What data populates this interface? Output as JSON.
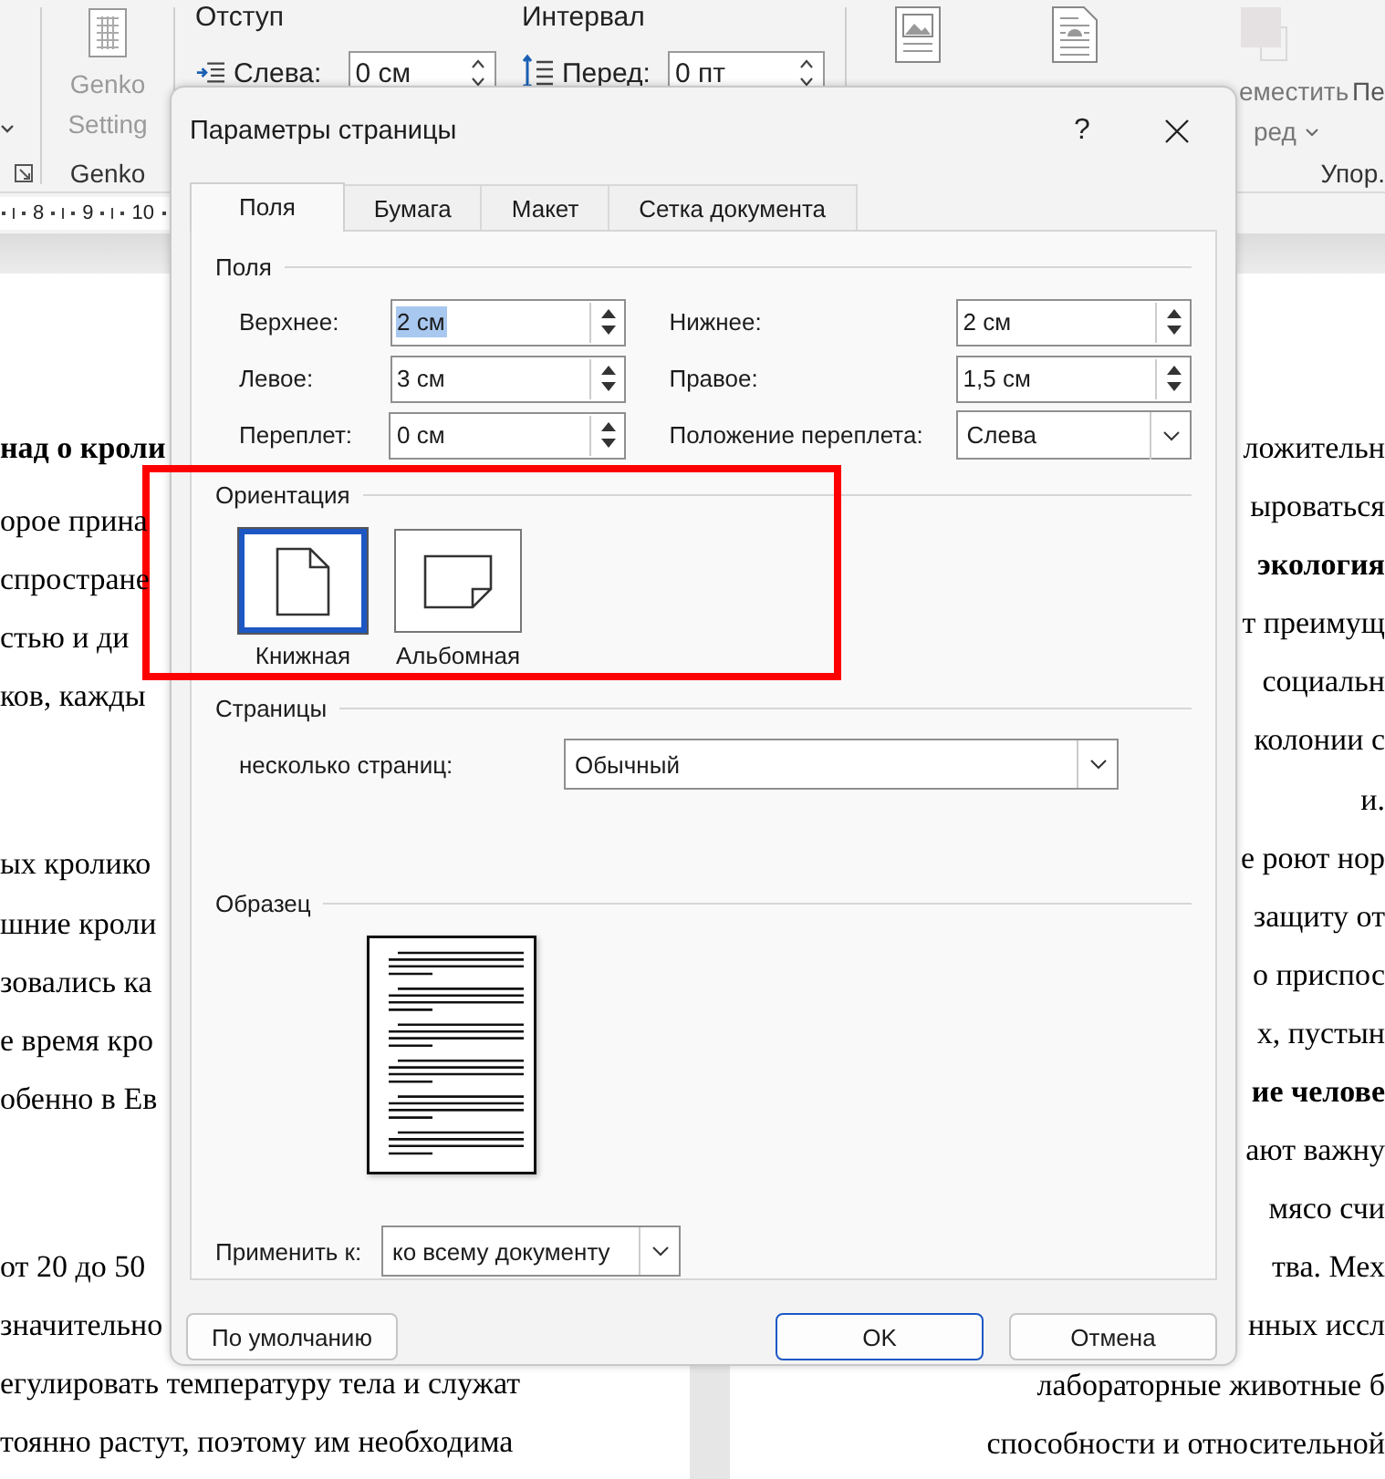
{
  "ribbon": {
    "genko": {
      "label_lines": [
        "Genko",
        "Setting"
      ],
      "group": "Genko",
      "disabled": true
    },
    "paragraph": [
      {
        "kind": "indent",
        "title": "Отступ",
        "label": "Слева:",
        "value": "0 см"
      },
      {
        "kind": "spacing",
        "title": "Интервал",
        "label": "Перед:",
        "value": "0 пт"
      }
    ],
    "arrange": {
      "group": "Упор.",
      "buttons": [
        {
          "kind": "picture",
          "disabled": false
        },
        {
          "kind": "wrap",
          "disabled": false
        },
        {
          "kind": "forward",
          "disabled": true,
          "lines": [
            "еместить",
            "ред"
          ],
          "dropdown": true
        },
        {
          "kind": "next",
          "disabled": false,
          "lines": [
            "Пе"
          ],
          "dropdown": false
        }
      ]
    }
  },
  "ruler": {
    "marks": [
      "8",
      "9",
      "10"
    ]
  },
  "document": {
    "left_page": [
      {
        "lines": [
          {
            "text": "над о кроли",
            "bold": true
          }
        ]
      },
      {
        "lines": [
          {
            "text": "орое прина",
            "bold": false
          },
          {
            "text": "спростране",
            "bold": false
          },
          {
            "text": "стью и ди",
            "bold": false
          },
          {
            "text": "ков, кажды",
            "bold": false
          }
        ]
      },
      {
        "lines": [
          {
            "text": "ых кролико",
            "bold": false
          },
          {
            "text": "шние кроли",
            "bold": false
          },
          {
            "text": "зовались ка",
            "bold": false
          },
          {
            "text": "е время кро",
            "bold": false
          },
          {
            "text": "обенно в Ев",
            "bold": false
          }
        ]
      },
      {
        "lines": [
          {
            "text": "от 20 до 50",
            "bold": false
          },
          {
            "text": "значительно",
            "bold": false
          },
          {
            "text": "егулировать температуру тела и служат",
            "bold": false
          },
          {
            "text": "тоянно растут, поэтому им необходима",
            "bold": false
          }
        ]
      }
    ],
    "right_page": [
      {
        "text": "ложительн",
        "bold": false
      },
      {
        "text": "ыроваться",
        "bold": false
      },
      {
        "text": "экология",
        "bold": true
      },
      {
        "text": "т преимущ",
        "bold": false
      },
      {
        "text": "социальн",
        "bold": false
      },
      {
        "text": "колонии с",
        "bold": false
      },
      {
        "text": "и.",
        "bold": false
      },
      {
        "text": "е роют нор",
        "bold": false
      },
      {
        "text": "защиту от",
        "bold": false
      },
      {
        "text": "о приспос",
        "bold": false
      },
      {
        "text": "х, пустын",
        "bold": false
      },
      {
        "text": "ие челове",
        "bold": true
      },
      {
        "text": "ают важну",
        "bold": false
      },
      {
        "text": "мясо счи",
        "bold": false
      },
      {
        "text": "тва. Мех",
        "bold": false
      },
      {
        "text": "нных иссл",
        "bold": false
      },
      {
        "text": "лабораторные животные б",
        "bold": false
      },
      {
        "text": "способности и относительной",
        "bold": false
      }
    ]
  },
  "dialog": {
    "title": "Параметры страницы",
    "help": "?",
    "tabs": [
      {
        "label": "Поля",
        "selected": true
      },
      {
        "label": "Бумага",
        "selected": false
      },
      {
        "label": "Макет",
        "selected": false
      },
      {
        "label": "Сетка документа",
        "selected": false
      }
    ],
    "margins": {
      "title": "Поля",
      "rows": [
        [
          {
            "label": "Верхнее:",
            "kind": "spin",
            "value": "2 см",
            "text_selected": true
          },
          {
            "label": "Нижнее:",
            "kind": "spin",
            "value": "2 см",
            "text_selected": false
          }
        ],
        [
          {
            "label": "Левое:",
            "kind": "spin",
            "value": "3 см",
            "text_selected": false
          },
          {
            "label": "Правое:",
            "kind": "spin",
            "value": "1,5 см",
            "text_selected": false
          }
        ],
        [
          {
            "label": "Переплет:",
            "kind": "spin",
            "value": "0 см",
            "text_selected": false
          },
          {
            "label": "Положение переплета:",
            "kind": "dropdown",
            "value": "Слева",
            "text_selected": false
          }
        ]
      ]
    },
    "orientation": {
      "title": "Ориентация",
      "options": [
        {
          "kind": "portrait",
          "label": "Книжная",
          "selected": true
        },
        {
          "kind": "landscape",
          "label": "Альбомная",
          "selected": false
        }
      ]
    },
    "pages": {
      "title": "Страницы",
      "label": "несколько страниц:",
      "value": "Обычный"
    },
    "preview": {
      "title": "Образец"
    },
    "apply": {
      "label": "Применить к:",
      "value": "ко всему документу"
    },
    "buttons": [
      {
        "label": "По умолчанию",
        "default": false
      },
      {
        "label": "OK",
        "default": true
      },
      {
        "label": "Отмена",
        "default": false
      }
    ]
  },
  "highlight": {
    "kind": "rectangle"
  }
}
